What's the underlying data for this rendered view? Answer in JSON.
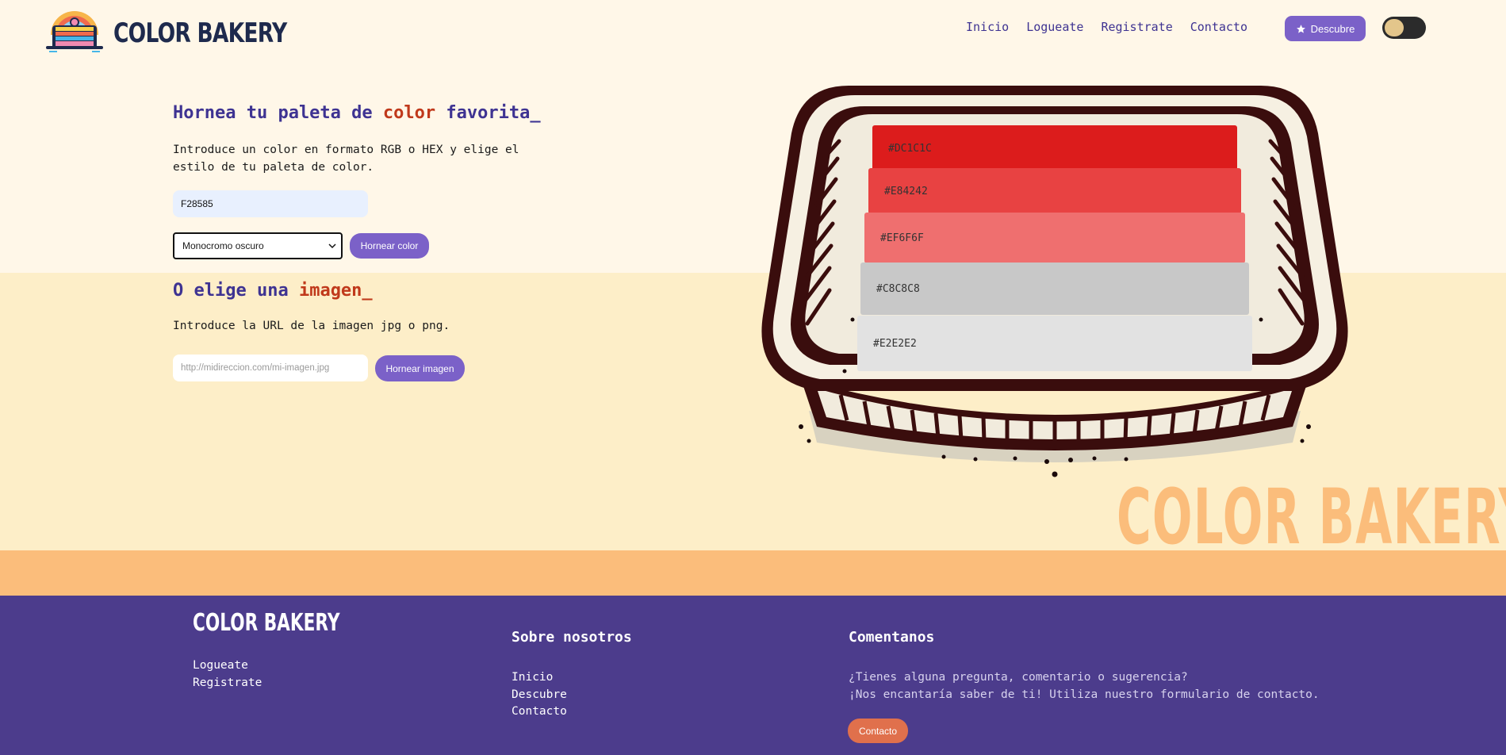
{
  "brand": {
    "name": "COLOR BAKERY"
  },
  "nav": {
    "items": [
      {
        "label": "Inicio"
      },
      {
        "label": "Logueate"
      },
      {
        "label": "Registrate"
      },
      {
        "label": "Contacto"
      }
    ],
    "discover_label": "Descubre",
    "theme_toggle": {
      "state": "light"
    }
  },
  "palette_form": {
    "title_start": "Hornea tu paleta de ",
    "title_accent": "color",
    "title_end": " favorita_",
    "description": "Introduce un color en formato RGB o HEX y elige el estilo de tu paleta de color.",
    "color_value": "F28585",
    "style_selected": "Monocromo oscuro",
    "submit_label": "Hornear color"
  },
  "image_form": {
    "title_start": "O elige una ",
    "title_accent": "imagen_",
    "description": "Introduce la URL de la imagen jpg o png.",
    "url_placeholder": "http://midireccion.com/mi-imagen.jpg",
    "submit_label": "Hornear imagen"
  },
  "palette": {
    "swatches": [
      {
        "hex": "#DC1C1C",
        "color": "#DC1C1C"
      },
      {
        "hex": "#E84242",
        "color": "#E84242"
      },
      {
        "hex": "#EF6F6F",
        "color": "#EF6F6F"
      },
      {
        "hex": "#C8C8C8",
        "color": "#C8C8C8"
      },
      {
        "hex": "#E2E2E2",
        "color": "#E2E2E2"
      }
    ]
  },
  "watermark": "COLOR BAKERY",
  "footer": {
    "brand": "COLOR BAKERY",
    "account_links": [
      {
        "label": "Logueate"
      },
      {
        "label": "Registrate"
      }
    ],
    "about": {
      "heading": "Sobre nosotros",
      "links": [
        {
          "label": "Inicio"
        },
        {
          "label": "Descubre"
        },
        {
          "label": "Contacto"
        }
      ]
    },
    "comments": {
      "heading": "Comentanos",
      "line1": "¿Tienes alguna pregunta, comentario o sugerencia?",
      "line2": "¡Nos encantaría saber de ti! Utiliza nuestro formulario de contacto.",
      "button_label": "Contacto"
    }
  },
  "colors": {
    "primary": "#3e3392",
    "accent": "#c0391b",
    "button": "#7b61c8",
    "footer_bg": "#4c3c8c",
    "orange_band": "#fbbd7b",
    "contact_button": "#e0704c"
  }
}
